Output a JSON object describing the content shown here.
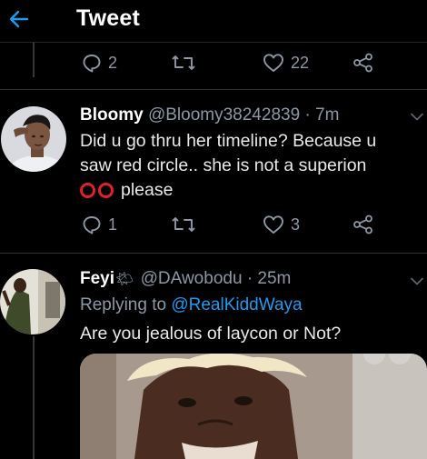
{
  "header": {
    "title": "Tweet"
  },
  "prev_tweet": {
    "actions": {
      "reply_count": "2",
      "retweet_count": "",
      "like_count": "22"
    }
  },
  "tweets": [
    {
      "name": "Bloomy",
      "handle": "@Bloomy38242839",
      "time": "· 7m",
      "text_line1": "Did u go thru her timeline? Because u",
      "text_line2": "saw red circle.. she is not a superion",
      "text_line3": "please",
      "emoji": "⭕⭕",
      "actions": {
        "reply_count": "1",
        "retweet_count": "",
        "like_count": "3"
      }
    },
    {
      "name": "Feyi",
      "emoji": "🌤",
      "handle": "@DAwobodu",
      "time": "· 25m",
      "replying_prefix": "Replying to",
      "replying_mention": "@RealKiddWaya",
      "text": "Are you jealous of laycon or Not?"
    }
  ],
  "colors": {
    "accent": "#1d9bf0",
    "muted": "#8b98a5",
    "background": "#000000",
    "circle_red": "#e0202a"
  }
}
